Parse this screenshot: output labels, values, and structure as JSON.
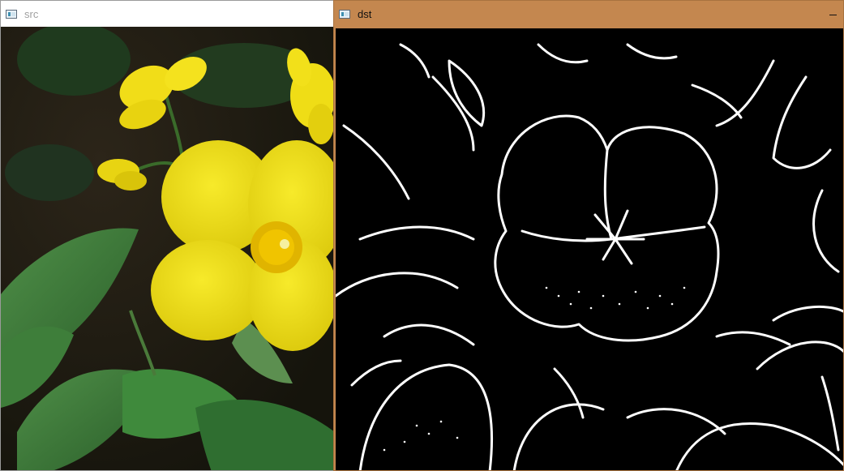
{
  "windows": {
    "src": {
      "title": "src",
      "icon": "opencv-window-icon"
    },
    "dst": {
      "title": "dst",
      "icon": "opencv-window-icon",
      "titlebar_color": "#c4874f",
      "minimize_icon": "minimize-icon"
    }
  },
  "colors": {
    "petal_yellow": "#f2e215",
    "stamen_orange": "#e0b400",
    "leaf_green": "#3a7a3a",
    "soil": "#2a2416",
    "edge_white": "#ffffff",
    "edge_bg": "#000000"
  }
}
